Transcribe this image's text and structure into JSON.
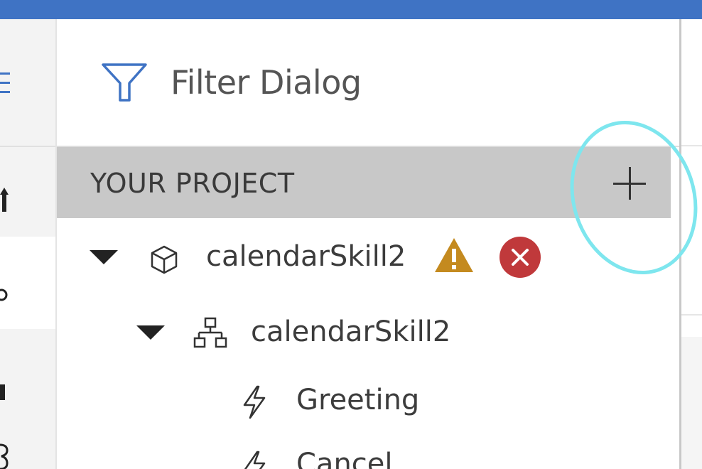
{
  "colors": {
    "accent_bar": "#3f73c4",
    "header_bg": "#c8c8c8",
    "warning": "#c48a1f",
    "error": "#c0393b",
    "highlight": "#7ee6ee"
  },
  "filter": {
    "icon": "filter-icon",
    "label": "Filter Dialog"
  },
  "project_header": {
    "title": "YOUR PROJECT",
    "add_icon": "plus-icon"
  },
  "tree": [
    {
      "label": "calendarSkill2",
      "icon": "cube-icon",
      "expanded": true,
      "badges": [
        "warning-icon",
        "error-icon"
      ]
    },
    {
      "label": "calendarSkill2",
      "icon": "hierarchy-icon",
      "expanded": true
    },
    {
      "label": "Greeting",
      "icon": "lightning-icon"
    },
    {
      "label": "Cancel",
      "icon": "lightning-icon"
    }
  ]
}
